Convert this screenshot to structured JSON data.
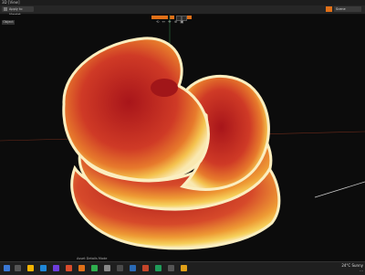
{
  "window": {
    "title": "3D [View]"
  },
  "menubar": {
    "left_label": "Apply to Viewlet",
    "scene_label": "Scene"
  },
  "viewport": {
    "view_label": "Object",
    "toolbar_icons": "⟲ ↔ ✥ ⊕ ▣"
  },
  "status": {
    "text": "Asset Details Mode"
  },
  "taskbar": {
    "weather": "24°C Sunny",
    "time": "…"
  },
  "colors": {
    "accent": "#e07018",
    "mushroom_red": "#c8322a",
    "mushroom_yellow": "#f2c24a"
  }
}
